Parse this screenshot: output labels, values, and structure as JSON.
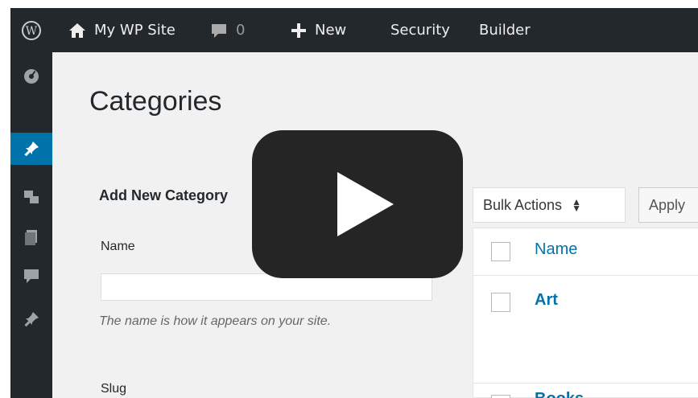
{
  "adminbar": {
    "site_name": "My WP Site",
    "comments_count": "0",
    "new_label": "New",
    "security_label": "Security",
    "builder_label": "Builder"
  },
  "page": {
    "title": "Categories"
  },
  "form": {
    "title": "Add New Category",
    "name_label": "Name",
    "name_help": "The name is how it appears on your site.",
    "slug_label": "Slug"
  },
  "list": {
    "bulk_actions_label": "Bulk Actions",
    "apply_label": "Apply",
    "column_name": "Name",
    "rows": [
      {
        "name": "Art"
      },
      {
        "name": "Books"
      }
    ]
  },
  "icons": {
    "wp": "wordpress-logo-icon",
    "home": "home-icon",
    "comment": "comment-icon",
    "plus": "plus-icon",
    "dashboard": "dashboard-icon",
    "pin": "pin-icon",
    "media": "media-icon",
    "pages": "pages-icon",
    "comments": "comments-icon",
    "play": "play-icon"
  },
  "colors": {
    "adminbar": "#23282d",
    "accent": "#0073aa",
    "play_button": "#252525"
  }
}
